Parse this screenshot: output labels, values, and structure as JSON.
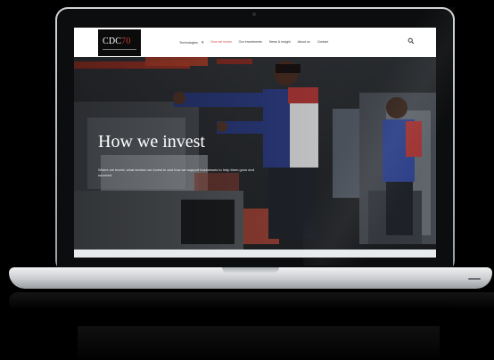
{
  "site": {
    "logo_text": "CDC",
    "logo_accent": "70",
    "nav": [
      {
        "label": "Technologies",
        "active": false,
        "has_dropdown": true
      },
      {
        "label": "How we invest",
        "active": true,
        "has_dropdown": false
      },
      {
        "label": "Our investments",
        "active": false,
        "has_dropdown": false
      },
      {
        "label": "News & insight",
        "active": false,
        "has_dropdown": false
      },
      {
        "label": "About us",
        "active": false,
        "has_dropdown": false
      },
      {
        "label": "Contact",
        "active": false,
        "has_dropdown": false
      }
    ],
    "search_icon": "search-icon"
  },
  "hero": {
    "title": "How we invest",
    "copy": "Where we invest, what sectors we invest in and how we support businesses to help them grow and succeed."
  },
  "colors": {
    "accent": "#d24a3b",
    "hero_title": "#ffffff",
    "hero_bg": "#2d2f34",
    "bezel": "#0c0d0e",
    "page_bg": "#000000"
  }
}
